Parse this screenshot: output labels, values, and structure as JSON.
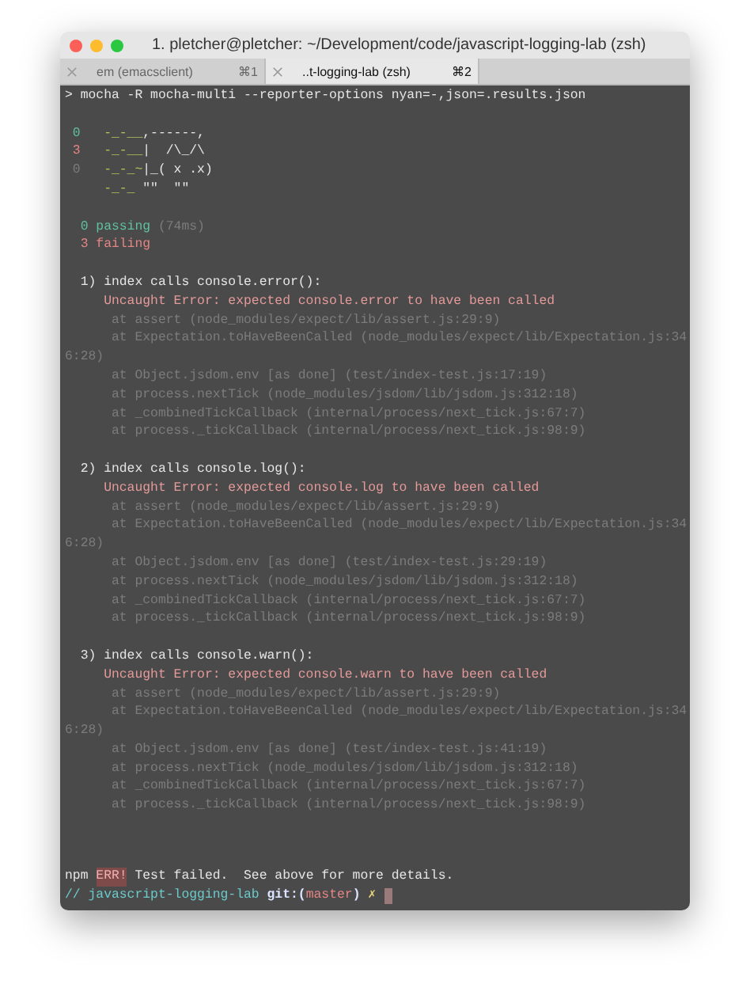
{
  "window": {
    "title": "1. pletcher@pletcher: ~/Development/code/javascript-logging-lab (zsh)"
  },
  "tabs": [
    {
      "label": "em (emacsclient)",
      "shortcut": "⌘1",
      "selected": false
    },
    {
      "label": "..t-logging-lab (zsh)",
      "shortcut": "⌘2",
      "selected": true
    }
  ],
  "output": [
    {
      "segments": [
        {
          "kind": "plain",
          "text": "> mocha -R mocha-multi --reporter-options nyan=-,json=.results.json"
        }
      ]
    },
    {
      "kind": "blank"
    },
    {
      "segments": [
        {
          "kind": "green",
          "text": " 0"
        },
        {
          "kind": "trail",
          "text": "   -_-__"
        },
        {
          "kind": "plain",
          "text": ",------,"
        }
      ]
    },
    {
      "segments": [
        {
          "kind": "red",
          "text": " 3"
        },
        {
          "kind": "trail",
          "text": "   -_-__"
        },
        {
          "kind": "plain",
          "text": "|  /\\_/\\"
        }
      ]
    },
    {
      "segments": [
        {
          "kind": "dim",
          "text": " 0"
        },
        {
          "kind": "trail",
          "text": "   -_-_~"
        },
        {
          "kind": "plain",
          "text": "|_( x .x)"
        }
      ]
    },
    {
      "segments": [
        {
          "kind": "trail",
          "text": "     -_-_"
        },
        {
          "kind": "plain",
          "text": " \"\"  \"\""
        }
      ]
    },
    {
      "kind": "blank"
    },
    {
      "segments": [
        {
          "kind": "green",
          "text": "  0 passing"
        },
        {
          "kind": "dim",
          "text": " (74ms)"
        }
      ]
    },
    {
      "segments": [
        {
          "kind": "red",
          "text": "  3 failing"
        }
      ]
    },
    {
      "kind": "blank"
    },
    {
      "segments": [
        {
          "kind": "plain",
          "text": "  1) index calls console.error():"
        }
      ]
    },
    {
      "segments": [
        {
          "kind": "error",
          "text": "     Uncaught Error: expected console.error to have been called"
        }
      ]
    },
    {
      "segments": [
        {
          "kind": "dim",
          "text": "      at assert (node_modules/expect/lib/assert.js:29:9)"
        }
      ]
    },
    {
      "segments": [
        {
          "kind": "dim",
          "text": "      at Expectation.toHaveBeenCalled (node_modules/expect/lib/Expectation.js:34"
        }
      ]
    },
    {
      "segments": [
        {
          "kind": "dim",
          "text": "6:28)"
        }
      ]
    },
    {
      "segments": [
        {
          "kind": "dim",
          "text": "      at Object.jsdom.env [as done] (test/index-test.js:17:19)"
        }
      ]
    },
    {
      "segments": [
        {
          "kind": "dim",
          "text": "      at process.nextTick (node_modules/jsdom/lib/jsdom.js:312:18)"
        }
      ]
    },
    {
      "segments": [
        {
          "kind": "dim",
          "text": "      at _combinedTickCallback (internal/process/next_tick.js:67:7)"
        }
      ]
    },
    {
      "segments": [
        {
          "kind": "dim",
          "text": "      at process._tickCallback (internal/process/next_tick.js:98:9)"
        }
      ]
    },
    {
      "kind": "blank"
    },
    {
      "segments": [
        {
          "kind": "plain",
          "text": "  2) index calls console.log():"
        }
      ]
    },
    {
      "segments": [
        {
          "kind": "error",
          "text": "     Uncaught Error: expected console.log to have been called"
        }
      ]
    },
    {
      "segments": [
        {
          "kind": "dim",
          "text": "      at assert (node_modules/expect/lib/assert.js:29:9)"
        }
      ]
    },
    {
      "segments": [
        {
          "kind": "dim",
          "text": "      at Expectation.toHaveBeenCalled (node_modules/expect/lib/Expectation.js:34"
        }
      ]
    },
    {
      "segments": [
        {
          "kind": "dim",
          "text": "6:28)"
        }
      ]
    },
    {
      "segments": [
        {
          "kind": "dim",
          "text": "      at Object.jsdom.env [as done] (test/index-test.js:29:19)"
        }
      ]
    },
    {
      "segments": [
        {
          "kind": "dim",
          "text": "      at process.nextTick (node_modules/jsdom/lib/jsdom.js:312:18)"
        }
      ]
    },
    {
      "segments": [
        {
          "kind": "dim",
          "text": "      at _combinedTickCallback (internal/process/next_tick.js:67:7)"
        }
      ]
    },
    {
      "segments": [
        {
          "kind": "dim",
          "text": "      at process._tickCallback (internal/process/next_tick.js:98:9)"
        }
      ]
    },
    {
      "kind": "blank"
    },
    {
      "segments": [
        {
          "kind": "plain",
          "text": "  3) index calls console.warn():"
        }
      ]
    },
    {
      "segments": [
        {
          "kind": "error",
          "text": "     Uncaught Error: expected console.warn to have been called"
        }
      ]
    },
    {
      "segments": [
        {
          "kind": "dim",
          "text": "      at assert (node_modules/expect/lib/assert.js:29:9)"
        }
      ]
    },
    {
      "segments": [
        {
          "kind": "dim",
          "text": "      at Expectation.toHaveBeenCalled (node_modules/expect/lib/Expectation.js:34"
        }
      ]
    },
    {
      "segments": [
        {
          "kind": "dim",
          "text": "6:28)"
        }
      ]
    },
    {
      "segments": [
        {
          "kind": "dim",
          "text": "      at Object.jsdom.env [as done] (test/index-test.js:41:19)"
        }
      ]
    },
    {
      "segments": [
        {
          "kind": "dim",
          "text": "      at process.nextTick (node_modules/jsdom/lib/jsdom.js:312:18)"
        }
      ]
    },
    {
      "segments": [
        {
          "kind": "dim",
          "text": "      at _combinedTickCallback (internal/process/next_tick.js:67:7)"
        }
      ]
    },
    {
      "segments": [
        {
          "kind": "dim",
          "text": "      at process._tickCallback (internal/process/next_tick.js:98:9)"
        }
      ]
    }
  ],
  "footer": [
    {
      "segments": [
        {
          "kind": "plain",
          "text": "npm "
        },
        {
          "kind": "badge",
          "text": "ERR!"
        },
        {
          "kind": "plain",
          "text": " Test failed.  See above for more details."
        }
      ]
    },
    {
      "segments": [
        {
          "kind": "cyan",
          "text": "// javascript-logging-lab "
        },
        {
          "kind": "bold",
          "text": "git:("
        },
        {
          "kind": "red",
          "text": "master"
        },
        {
          "kind": "bold",
          "text": ")"
        },
        {
          "kind": "yellow",
          "text": " ✗"
        }
      ],
      "cursor": true
    }
  ]
}
